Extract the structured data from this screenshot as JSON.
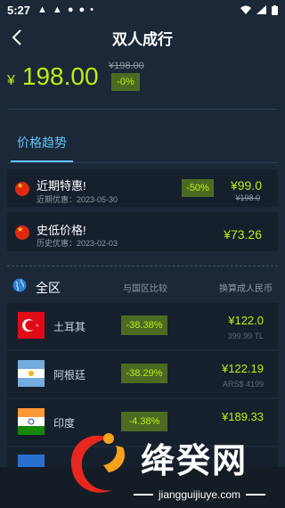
{
  "status_bar": {
    "time": "5:27",
    "left_icons": [
      "app-a-icon",
      "app-a2-icon",
      "chat-icon",
      "chat2-icon",
      "dot-icon"
    ],
    "right_icons": [
      "wifi-icon",
      "signal-icon",
      "battery-icon"
    ]
  },
  "header": {
    "title": "双人成行"
  },
  "price": {
    "currency": "¥",
    "current": "198.00",
    "original": "¥198.00",
    "discount": "-0%"
  },
  "tabs": [
    {
      "label": "价格趋势",
      "active": true
    }
  ],
  "offers": [
    {
      "title": "近期特惠!",
      "subtitle": "近期优惠：2023-05-30",
      "discount": "-50%",
      "price": "¥99.0",
      "original": "¥198.0"
    },
    {
      "title": "史低价格!",
      "subtitle": "历史优惠：2023-02-03",
      "price": "¥73.26"
    }
  ],
  "region": {
    "label": "全区",
    "col_compare": "与国区比较",
    "col_rmb": "换算成人民币"
  },
  "countries": [
    {
      "name": "土耳其",
      "diff": "-38.38%",
      "rmb": "¥122.0",
      "local": "399.99 TL",
      "flag": "turkey"
    },
    {
      "name": "阿根廷",
      "diff": "-38.29%",
      "rmb": "¥122.19",
      "local": "ARS$ 4199",
      "flag": "argentina"
    },
    {
      "name": "印度",
      "diff": "-4.38%",
      "rmb": "¥189.33",
      "local": "",
      "flag": "india"
    }
  ],
  "watermark": {
    "text": "绛癸网",
    "url": "jiangguijiuye.com"
  },
  "colors": {
    "background": "#1b2838",
    "accent_green": "#beee11",
    "discount_bg": "#4c6b22",
    "link_blue": "#66c0f4"
  }
}
